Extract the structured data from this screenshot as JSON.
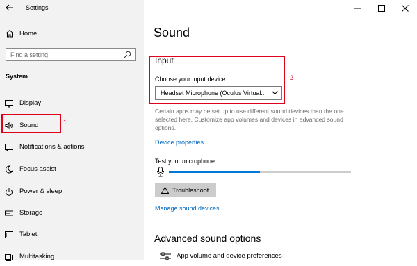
{
  "window": {
    "title": "Settings"
  },
  "sidebar": {
    "home_label": "Home",
    "search": {
      "placeholder": "Find a setting"
    },
    "section_label": "System",
    "items": [
      {
        "label": "Display",
        "icon": "monitor-icon"
      },
      {
        "label": "Sound",
        "icon": "speaker-icon",
        "selected": true
      },
      {
        "label": "Notifications & actions",
        "icon": "notification-icon"
      },
      {
        "label": "Focus assist",
        "icon": "moon-icon"
      },
      {
        "label": "Power & sleep",
        "icon": "power-icon"
      },
      {
        "label": "Storage",
        "icon": "storage-icon"
      },
      {
        "label": "Tablet",
        "icon": "tablet-icon"
      },
      {
        "label": "Multitasking",
        "icon": "multitasking-icon"
      }
    ]
  },
  "main": {
    "title": "Sound",
    "input": {
      "heading": "Input",
      "device_label": "Choose your input device",
      "device_value": "Headset Microphone (Oculus Virtual..."
    },
    "description": "Certain apps may be set up to use different sound devices than the one selected here. Customize app volumes and devices in advanced sound options.",
    "device_properties_link": "Device properties",
    "mic_test": {
      "label": "Test your microphone",
      "level_fraction": 0.5
    },
    "troubleshoot_label": "Troubleshoot",
    "manage_devices_link": "Manage sound devices",
    "advanced_title": "Advanced sound options",
    "app_volume_label": "App volume and device preferences"
  },
  "annotations": {
    "marker_1": "1",
    "marker_2": "2"
  },
  "colors": {
    "accent": "#0078d7",
    "link": "#0067c0",
    "annotation": "#e1001a",
    "sidebar_bg": "#f2f2f2"
  }
}
